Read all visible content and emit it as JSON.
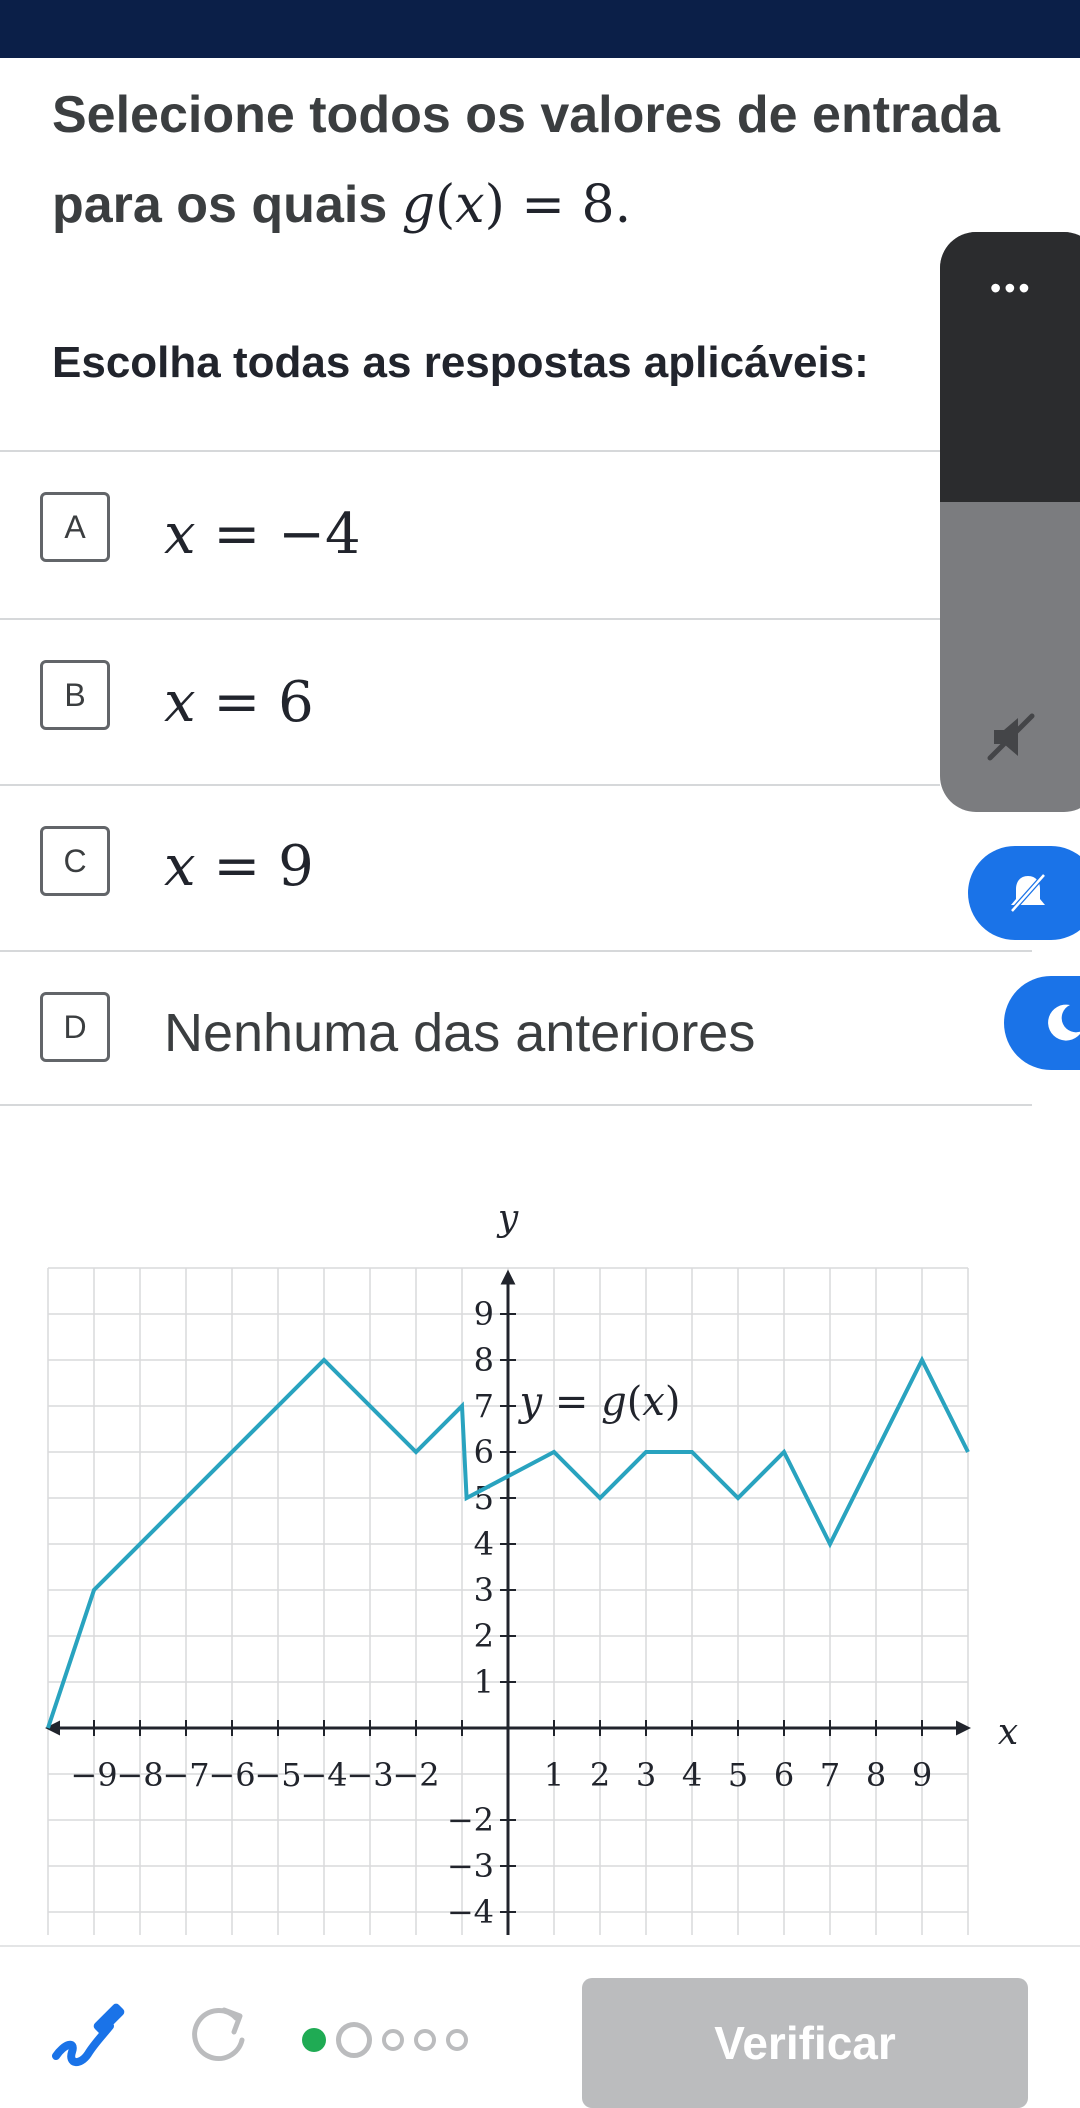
{
  "question": {
    "prefix": "Selecione todos os valores de entrada",
    "line2": "para os quais",
    "math_fn": "g",
    "math_var": "x",
    "math_rest": ") = 8."
  },
  "instruction": "Escolha todas as respostas aplicáveis:",
  "choices": [
    {
      "letter": "A",
      "var": "x",
      "rest": " = −4"
    },
    {
      "letter": "B",
      "var": "x",
      "rest": " = 6"
    },
    {
      "letter": "C",
      "var": "x",
      "rest": " = 9"
    },
    {
      "letter": "D",
      "text": "Nenhuma das anteriores"
    }
  ],
  "side_panel": {
    "more_label": "•••",
    "icons": [
      "more-horizontal-icon",
      "volume-mute-icon",
      "notifications-off-icon",
      "moon-icon"
    ]
  },
  "graph": {
    "x_axis_label": "x",
    "y_axis_label": "y",
    "curve_label_fn": "g",
    "curve_label_var": "x",
    "curve_label_prefix": "y = ",
    "curve_label_suffix": ")",
    "x_ticks_neg": [
      "−9",
      "−8",
      "−7",
      "−6",
      "−5",
      "−4",
      "−3",
      "−2"
    ],
    "x_ticks_pos": [
      "1",
      "2",
      "3",
      "4",
      "5",
      "6",
      "7",
      "8",
      "9"
    ],
    "y_ticks_pos": [
      "1",
      "2",
      "3",
      "4",
      "5",
      "6",
      "7",
      "8",
      "9"
    ],
    "y_ticks_neg": [
      "−2",
      "−3",
      "−4"
    ],
    "curve_color": "#29a3bf"
  },
  "chart_data": {
    "type": "line",
    "xlim": [
      -10,
      10
    ],
    "ylim": [
      -4.5,
      10
    ],
    "grid": true,
    "series": [
      {
        "x": [
          -10,
          -9,
          -4,
          -2,
          -1,
          -0.9,
          1,
          2,
          3,
          4,
          5,
          6,
          7,
          9,
          10
        ],
        "y": [
          0,
          3,
          8,
          6,
          7,
          5,
          6,
          5,
          6,
          6,
          5,
          6,
          4,
          8,
          6
        ]
      }
    ]
  },
  "bottom": {
    "check_label": "Verificar",
    "progress_total": 5,
    "progress_current": 1,
    "accent_green": "#1fab54"
  }
}
